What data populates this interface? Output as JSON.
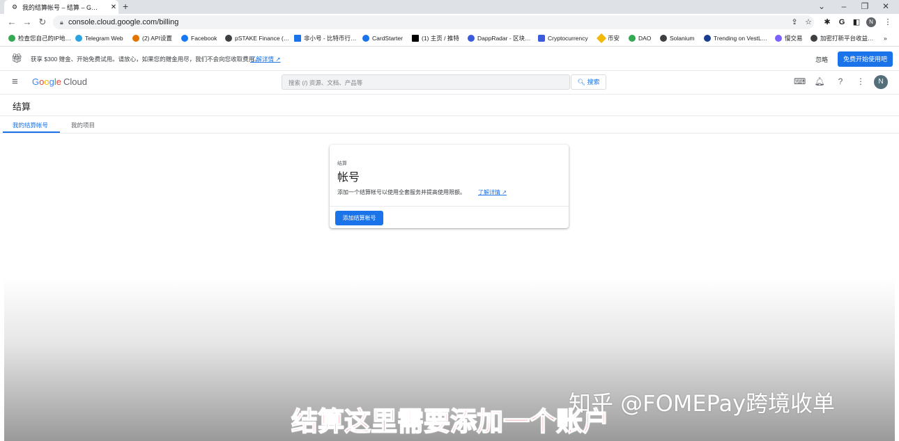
{
  "browser": {
    "tab_title": "我的结算帐号 – 结算 – G…",
    "url": "console.cloud.google.com/billing",
    "profile_initial": "N"
  },
  "bookmarks": [
    {
      "label": "检查您自己的IP地…",
      "color": "#34a853"
    },
    {
      "label": "Telegram Web",
      "color": "#2aa3df"
    },
    {
      "label": "(2) API设置",
      "color": "#e37400"
    },
    {
      "label": "Facebook",
      "color": "#1877f2"
    },
    {
      "label": "pSTAKE Finance (…",
      "color": "#3c4043"
    },
    {
      "label": "非小号 - 比特币行…",
      "color": "#1a73e8"
    },
    {
      "label": "CardStarter",
      "color": "#1a73e8"
    },
    {
      "label": "(1) 主页 / 推特",
      "color": "#000000"
    },
    {
      "label": "DappRadar - 区块…",
      "color": "#3b5bdb"
    },
    {
      "label": "Cryptocurrency",
      "color": "#3b5bdb"
    },
    {
      "label": "币安",
      "color": "#f0b90b"
    },
    {
      "label": "DAO",
      "color": "#34a853"
    },
    {
      "label": "Solanium",
      "color": "#3c4043"
    },
    {
      "label": "Trending on VestL…",
      "color": "#1a3e8f"
    },
    {
      "label": "慢交易",
      "color": "#7b61ff"
    },
    {
      "label": "加密打新平台收益…",
      "color": "#3c4043"
    }
  ],
  "promo": {
    "text": "获享 $300 赠金、开始免费试用。请放心，如果您的赠金用尽，我们不会向您收取费用。",
    "link": "了解详情",
    "dismiss": "忽略",
    "cta": "免费开始使用吧"
  },
  "header": {
    "logo_google": [
      "G",
      "o",
      "o",
      "g",
      "l",
      "e"
    ],
    "logo_cloud": "Cloud",
    "search_placeholder": "搜索 (/) 资源、文档、产品等",
    "search_button": "搜索",
    "avatar": "N"
  },
  "page": {
    "title": "结算",
    "tabs": [
      "我的结算帐号",
      "我的项目"
    ]
  },
  "card": {
    "eyebrow": "结算",
    "title": "帐号",
    "description": "添加一个结算帐号以使用全套服务并提高使用限额。",
    "link": "了解详情",
    "button": "添加结算帐号"
  },
  "overlay": {
    "watermark": "知乎 @FOMEPay跨境收单",
    "subtitle": "结算这里需要添加一个账户"
  },
  "colors": {
    "accent": "#1a73e8",
    "subtitle_red": "#e8232b"
  }
}
